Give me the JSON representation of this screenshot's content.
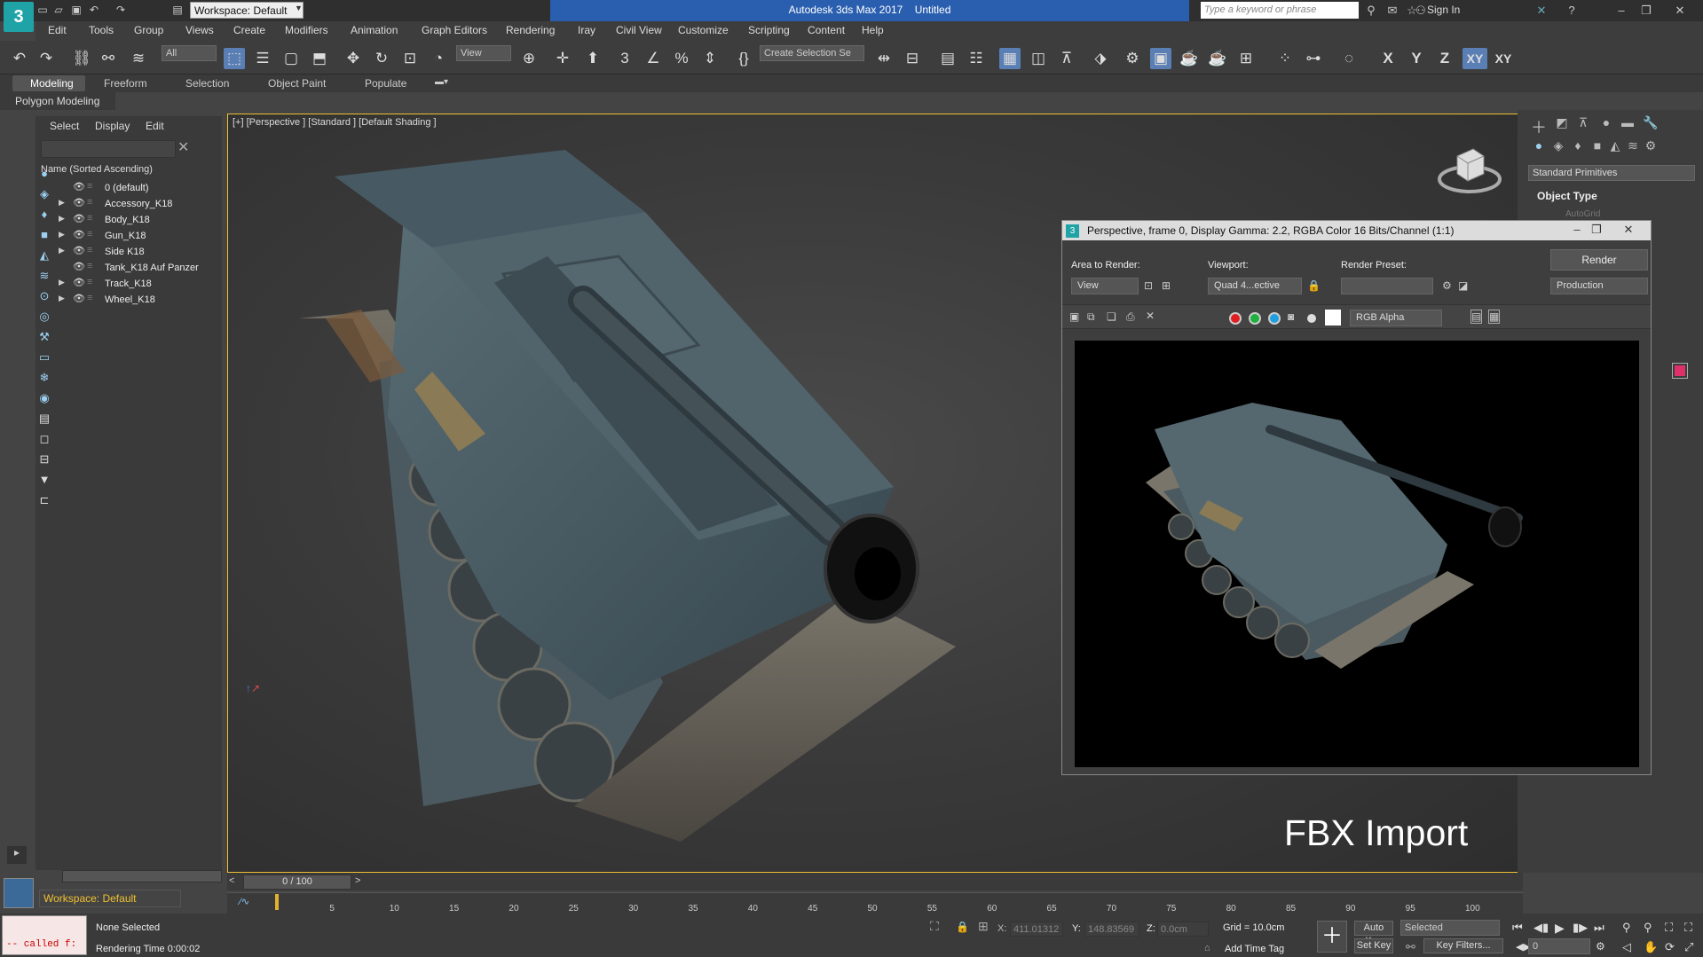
{
  "titlebar": {
    "app_title": "Autodesk 3ds Max 2017",
    "doc_title": "Untitled",
    "workspace": "Workspace: Default",
    "search_placeholder": "Type a keyword or phrase",
    "sign_in": "Sign In",
    "logo": "3"
  },
  "menu": [
    "Edit",
    "Tools",
    "Group",
    "Views",
    "Create",
    "Modifiers",
    "Animation",
    "Graph Editors",
    "Rendering",
    "Iray",
    "Civil View",
    "Customize",
    "Scripting",
    "Content",
    "Help"
  ],
  "toolbar": {
    "selection_filter": "All",
    "ref_coord": "View",
    "create_selection_set": "Create Selection Se",
    "axis": [
      "X",
      "Y",
      "Z",
      "XY",
      "XY"
    ]
  },
  "ribbon": {
    "tabs": [
      "Modeling",
      "Freeform",
      "Selection",
      "Object Paint",
      "Populate"
    ],
    "sub": "Polygon Modeling"
  },
  "scene_explorer": {
    "menu": [
      "Select",
      "Display",
      "Edit"
    ],
    "header": "Name (Sorted Ascending)",
    "items": [
      {
        "name": "0 (default)",
        "expand": false
      },
      {
        "name": "Accessory_K18",
        "expand": true
      },
      {
        "name": "Body_K18",
        "expand": true
      },
      {
        "name": "Gun_K18",
        "expand": true
      },
      {
        "name": "Side K18",
        "expand": true
      },
      {
        "name": "Tank_K18 Auf Panzer",
        "expand": false
      },
      {
        "name": "Track_K18",
        "expand": true
      },
      {
        "name": "Wheel_K18",
        "expand": true
      }
    ]
  },
  "viewport": {
    "label": "[+] [Perspective ] [Standard ] [Default Shading ]",
    "overlay": "FBX Import"
  },
  "command_panel": {
    "dropdown": "Standard Primitives",
    "section": "Object Type",
    "autogrid": "AutoGrid",
    "accent": "#e0306a"
  },
  "render_window": {
    "title": "Perspective, frame 0, Display Gamma: 2.2, RGBA Color 16 Bits/Channel (1:1)",
    "area_label": "Area to Render:",
    "area_value": "View",
    "viewport_label": "Viewport:",
    "viewport_value": "Quad 4...ective",
    "preset_label": "Render Preset:",
    "preset_value": "",
    "render_button": "Render",
    "production": "Production",
    "channel": "RGB Alpha"
  },
  "timeline": {
    "slider": "0 / 100",
    "ticks": [
      "5",
      "10",
      "15",
      "20",
      "25",
      "30",
      "35",
      "40",
      "45",
      "50",
      "55",
      "60",
      "65",
      "70",
      "75",
      "80",
      "85",
      "90",
      "95",
      "100"
    ]
  },
  "status": {
    "workspace": "Workspace: Default",
    "maxscript": "-- called f:",
    "selection": "None Selected",
    "render_time": "Rendering Time  0:00:02",
    "x_label": "X:",
    "x": "411.01312",
    "y_label": "Y:",
    "y": "148.83569",
    "z_label": "Z:",
    "z": "0.0cm",
    "grid": "Grid = 10.0cm",
    "add_time_tag": "Add Time Tag",
    "auto_key": "Auto Key",
    "selected": "Selected",
    "set_key": "Set Key",
    "key_filters": "Key Filters...",
    "frame": "0"
  }
}
